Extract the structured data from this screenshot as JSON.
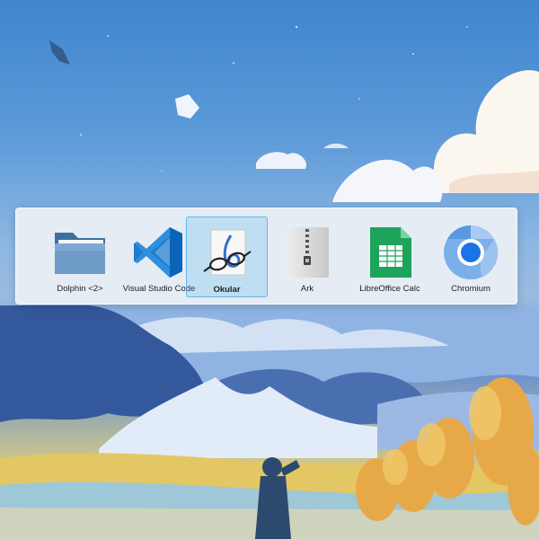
{
  "task_switcher": {
    "items": [
      {
        "label": "Dolphin <2>",
        "icon": "folder-icon",
        "selected": false
      },
      {
        "label": "Visual Studio Code",
        "icon": "vscode-icon",
        "selected": false
      },
      {
        "label": "Okular",
        "icon": "okular-icon",
        "selected": true
      },
      {
        "label": "Ark",
        "icon": "archive-icon",
        "selected": false
      },
      {
        "label": "LibreOffice Calc",
        "icon": "spreadsheet-icon",
        "selected": false
      },
      {
        "label": "Chromium",
        "icon": "chromium-icon",
        "selected": false
      }
    ]
  },
  "colors": {
    "selection_accent": "#3daee9",
    "switcher_background": "#eceff5"
  }
}
